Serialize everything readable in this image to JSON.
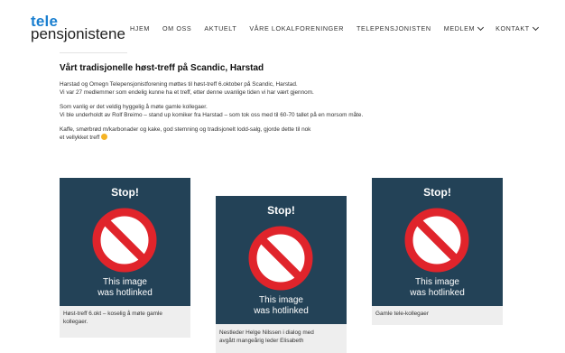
{
  "header": {
    "logo_top": "tele",
    "logo_bottom": "pensjonistene",
    "nav": [
      {
        "label": "HJEM"
      },
      {
        "label": "OM OSS"
      },
      {
        "label": "AKTUELT"
      },
      {
        "label": "VÅRE LOKALFORENINGER"
      },
      {
        "label": "TELEPENSJONISTEN"
      },
      {
        "label": "MEDLEM"
      },
      {
        "label": "KONTAKT"
      }
    ]
  },
  "article": {
    "title": "Vårt tradisjonelle høst-treff på Scandic, Harstad",
    "paragraphs": [
      [
        "Harstad og Omegn Telepensjonistforening møttes til høst-treff 6.oktober på Scandic, Harstad.",
        "Vi var 27 medlemmer som endelig kunne ha et treff, etter denne uvanlige tiden vi har vært gjennom."
      ],
      [
        "Som vanlig er det veldig hyggelig å møte gamle kollegaer.",
        "Vi ble underholdt av Rolf Breimo – stand up komiker fra Harstad – som tok oss med til 60-70 tallet på en morsom måte."
      ],
      [
        "Kaffe, smørbrød m/karbonader og kake, god stemning og tradisjonelt lodd-salg, gjorde dette til nok",
        "et vellykket treff"
      ]
    ]
  },
  "gallery": [
    {
      "stop": "Stop!",
      "line1": "This image",
      "line2": "was hotlinked",
      "caption": [
        "Høst-treff 6.okt – koselig å møte gamle",
        "kollegaer."
      ]
    },
    {
      "stop": "Stop!",
      "line1": "This image",
      "line2": "was hotlinked",
      "caption": [
        "Nestleder Helge Nilssen i dialog med",
        "avgått mangeårig leder Elisabeth"
      ]
    },
    {
      "stop": "Stop!",
      "line1": "This image",
      "line2": "was hotlinked",
      "caption": [
        "Gamle tele-kollegaer"
      ]
    }
  ],
  "colors": {
    "accent": "#1a7fd0",
    "image_bg": "#234257",
    "stop_sign": "#e0242b"
  }
}
